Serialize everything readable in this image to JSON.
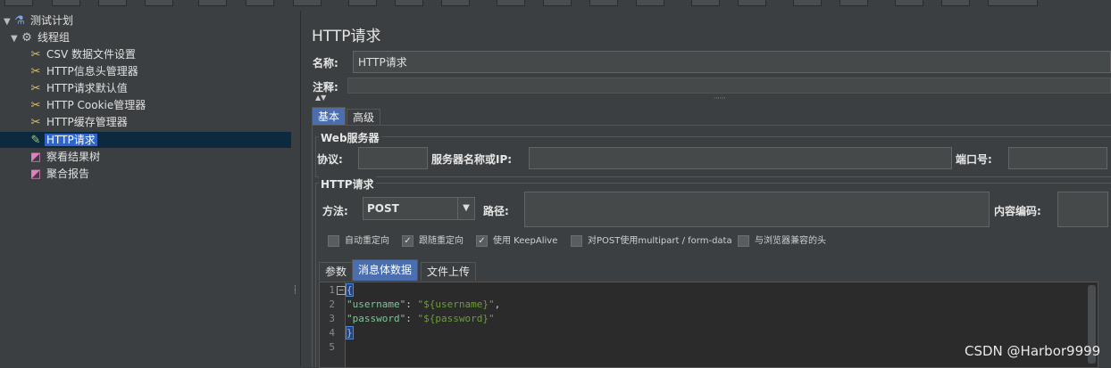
{
  "tree": {
    "nodes": [
      {
        "label": "测试计划",
        "icon": "flask-icon"
      },
      {
        "label": "线程组",
        "icon": "gear-icon"
      },
      {
        "label": "CSV 数据文件设置",
        "icon": "wrench-icon"
      },
      {
        "label": "HTTP信息头管理器",
        "icon": "wrench-icon"
      },
      {
        "label": "HTTP请求默认值",
        "icon": "wrench-icon"
      },
      {
        "label": "HTTP Cookie管理器",
        "icon": "wrench-icon"
      },
      {
        "label": "HTTP缓存管理器",
        "icon": "wrench-icon"
      },
      {
        "label": "HTTP请求",
        "icon": "pipette-icon"
      },
      {
        "label": "察看结果树",
        "icon": "chart-icon"
      },
      {
        "label": "聚合报告",
        "icon": "chart-icon"
      }
    ]
  },
  "panel": {
    "title": "HTTP请求",
    "name_label": "名称:",
    "name_value": "HTTP请求",
    "comment_label": "注释:",
    "comment_value": "",
    "tabs": [
      "基本",
      "高级"
    ],
    "web_server": {
      "title": "Web服务器",
      "protocol_label": "协议:",
      "protocol_value": "",
      "server_label": "服务器名称或IP:",
      "server_value": "",
      "port_label": "端口号:",
      "port_value": ""
    },
    "http_request": {
      "title": "HTTP请求",
      "method_label": "方法:",
      "method_value": "POST",
      "path_label": "路径:",
      "path_value": "",
      "encoding_label": "内容编码:",
      "encoding_value": ""
    },
    "checkboxes": [
      {
        "label": "自动重定向",
        "checked": false
      },
      {
        "label": "跟随重定向",
        "checked": true
      },
      {
        "label": "使用 KeepAlive",
        "checked": true
      },
      {
        "label": "对POST使用multipart / form-data",
        "checked": false
      },
      {
        "label": "与浏览器兼容的头",
        "checked": false
      }
    ],
    "body_tabs": [
      "参数",
      "消息体数据",
      "文件上传"
    ],
    "editor": {
      "line_numbers": [
        "1",
        "2",
        "3",
        "4",
        "5"
      ],
      "open_brace": "{",
      "close_brace": "}",
      "key1": "\"username\"",
      "val1": "\"${username}\"",
      "key2": "\"password\"",
      "val2": "\"${password}\"",
      "colon": ": ",
      "comma": ","
    }
  },
  "watermark": "CSDN @Harbor9999"
}
